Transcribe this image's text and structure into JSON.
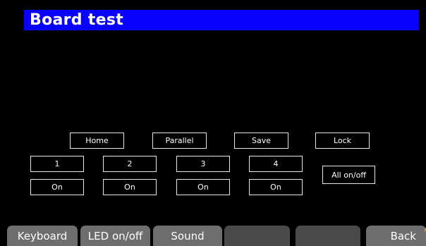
{
  "title": "Board test",
  "modes": {
    "home": "Home",
    "parallel": "Parallel",
    "save": "Save",
    "lock": "Lock"
  },
  "channels": [
    {
      "label": "1",
      "state": "On"
    },
    {
      "label": "2",
      "state": "On"
    },
    {
      "label": "3",
      "state": "On"
    },
    {
      "label": "4",
      "state": "On"
    }
  ],
  "all_toggle": "All on/off",
  "softkeys": {
    "keyboard": "Keyboard",
    "led": "LED on/off",
    "sound": "Sound",
    "blank1": "",
    "blank2": "",
    "back": "Back"
  },
  "colors": {
    "title_bar": "#0a00ff",
    "background": "#000000",
    "softkey": "#6e6e6e",
    "softkey_empty": "#4a4a4a",
    "corner_mark": "#e38a1a"
  }
}
